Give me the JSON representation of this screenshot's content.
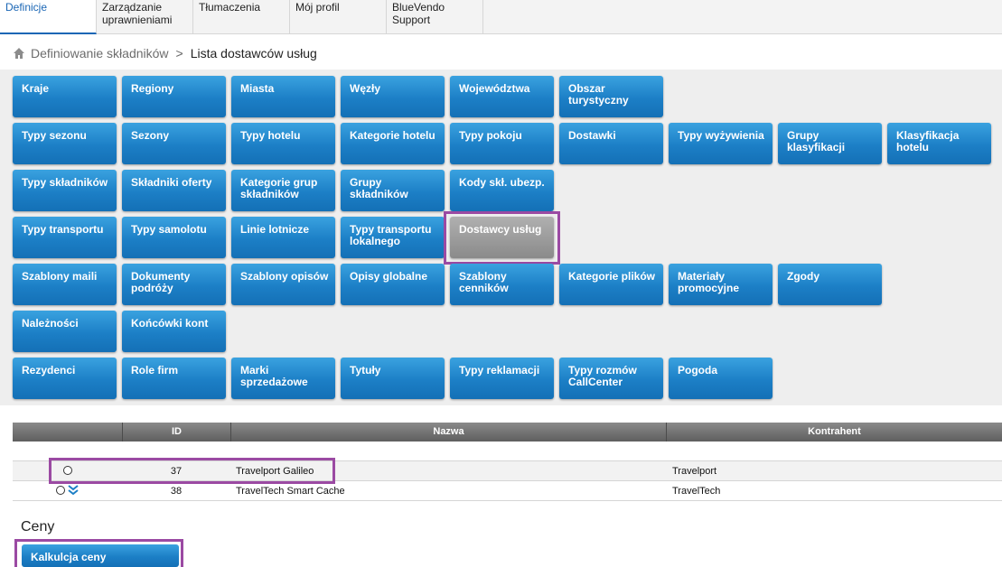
{
  "tabs": [
    "Definicje",
    "Zarządzanie uprawnieniami",
    "Tłumaczenia",
    "Mój profil",
    "BlueVendo Support"
  ],
  "breadcrumb": {
    "parent": "Definiowanie składników",
    "separator": ">",
    "current": "Lista dostawców usług"
  },
  "tiles": {
    "r1": [
      "Kraje",
      "Regiony",
      "Miasta",
      "Węzły",
      "Województwa",
      "Obszar turystyczny"
    ],
    "r2": [
      "Typy sezonu",
      "Sezony",
      "Typy hotelu",
      "Kategorie hotelu",
      "Typy pokoju",
      "Dostawki",
      "Typy wyżywienia",
      "Grupy klasyfikacji",
      "Klasyfikacja hotelu"
    ],
    "r3": [
      "Typy składników",
      "Składniki oferty",
      "Kategorie grup składników",
      "Grupy składników",
      "Kody skł. ubezp."
    ],
    "r4": [
      "Typy transportu",
      "Typy samolotu",
      "Linie lotnicze",
      "Typy transportu lokalnego",
      "Dostawcy usług"
    ],
    "r5": [
      "Szablony maili",
      "Dokumenty podróży",
      "Szablony opisów",
      "Opisy globalne",
      "Szablony cenników",
      "Kategorie plików",
      "Materiały promocyjne",
      "Zgody"
    ],
    "r6": [
      "Należności",
      "Końcówki kont"
    ],
    "r7": [
      "Rezydenci",
      "Role firm",
      "Marki sprzedażowe",
      "Tytuły",
      "Typy reklamacji",
      "Typy rozmów CallCenter",
      "Pogoda"
    ]
  },
  "selected_tile": "Dostawcy usług",
  "table": {
    "headers": [
      "",
      "ID",
      "Nazwa",
      "Kontrahent"
    ],
    "rows": [
      {
        "id": "37",
        "name": "Travelport Galileo",
        "contractor": "Travelport"
      },
      {
        "id": "38",
        "name": "TravelTech Smart Cache",
        "contractor": "TravelTech"
      }
    ]
  },
  "prices": {
    "title": "Ceny",
    "button": "Kalkulcja ceny"
  },
  "colors": {
    "tile_blue": "#1c7fc6",
    "tile_selected": "#8a8a8a",
    "highlight": "#9b4aa3",
    "active_tab": "#1a66b5"
  },
  "icons": {
    "home": "home-icon",
    "expand": "chevron-double-down-icon"
  }
}
